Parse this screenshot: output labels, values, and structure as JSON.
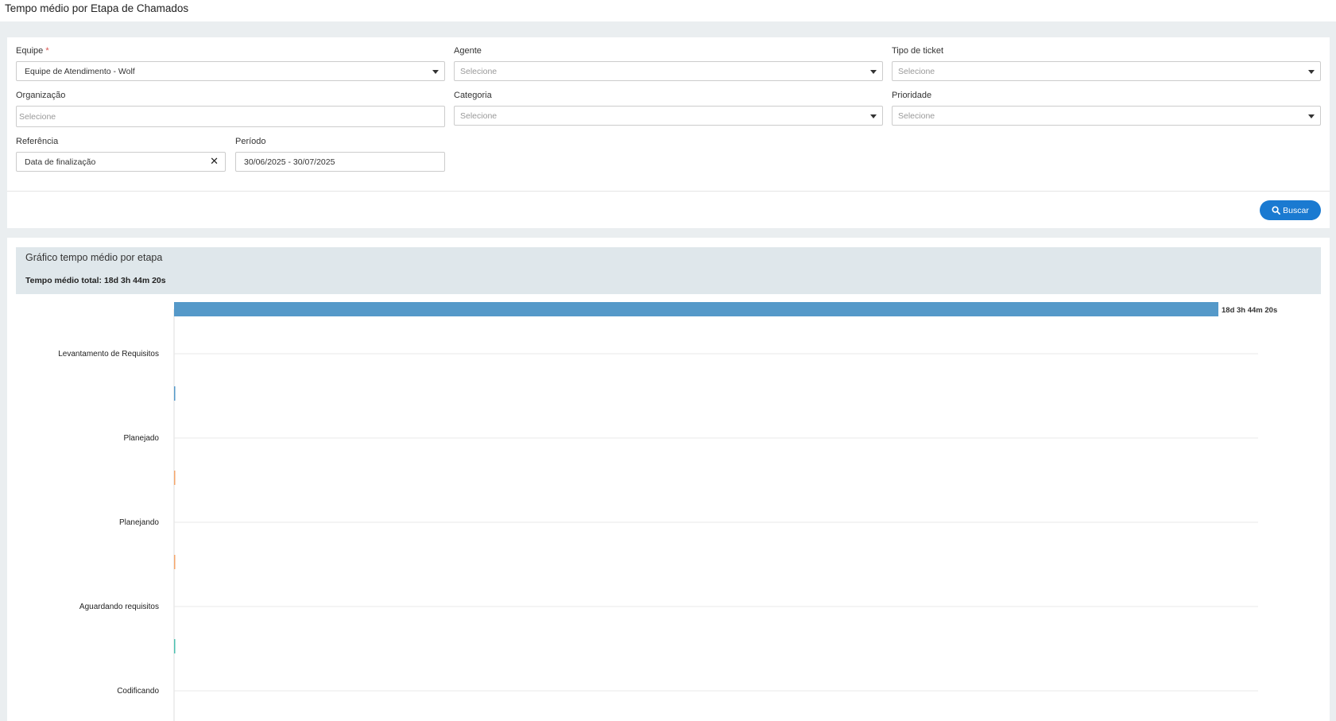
{
  "page": {
    "title": "Tempo médio por Etapa de Chamados"
  },
  "filters": {
    "equipe": {
      "label": "Equipe",
      "required_mark": "*",
      "value": "Equipe de Atendimento - Wolf"
    },
    "agente": {
      "label": "Agente",
      "placeholder": "Selecione"
    },
    "tipo_ticket": {
      "label": "Tipo de ticket",
      "placeholder": "Selecione"
    },
    "organizacao": {
      "label": "Organização",
      "placeholder": "Selecione"
    },
    "categoria": {
      "label": "Categoria",
      "placeholder": "Selecione"
    },
    "prioridade": {
      "label": "Prioridade",
      "placeholder": "Selecione"
    },
    "referencia": {
      "label": "Referência",
      "value": "Data de finalização"
    },
    "periodo": {
      "label": "Período",
      "value": "30/06/2025 - 30/07/2025"
    },
    "search_button": {
      "label": "Buscar",
      "icon": "search-icon"
    },
    "clear_icon": "close-icon"
  },
  "chart_panel": {
    "title": "Gráfico tempo médio por etapa",
    "total_text": "Tempo médio total: 18d 3h 44m 20s"
  },
  "colors": {
    "primary_button": "#1a7ad1",
    "bar_main": "#5599c9",
    "bar_orange": "#f5a66b",
    "bar_teal": "#4cc0b0"
  },
  "chart_data": {
    "type": "bar",
    "orientation": "horizontal",
    "categories": [
      "Levantamento de Requisitos",
      "Planejado",
      "Planejando",
      "Aguardando requisitos",
      "Codificando"
    ],
    "values_seconds": [
      1568660,
      0,
      0,
      0,
      0
    ],
    "data_labels": [
      "18d 3h 44m 20s",
      "",
      "",
      "",
      ""
    ],
    "bar_colors": [
      "#5599c9",
      "#5599c9",
      "#f5a66b",
      "#f5a66b",
      "#4cc0b0"
    ],
    "grid": true,
    "xlabel": "",
    "ylabel": ""
  }
}
